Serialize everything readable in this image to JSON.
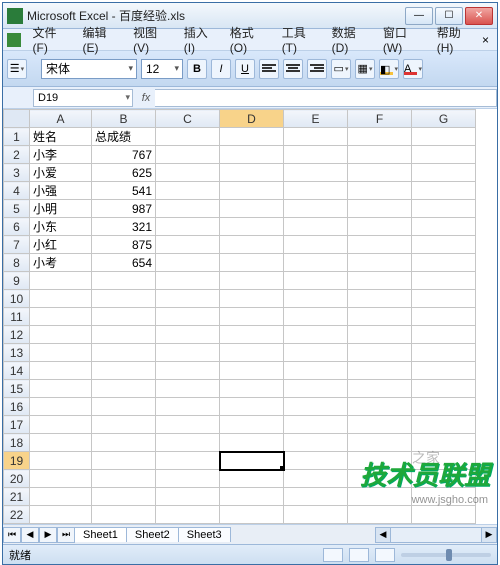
{
  "window": {
    "title": "Microsoft Excel - 百度经验.xls"
  },
  "menu": {
    "file": "文件(F)",
    "edit": "编辑(E)",
    "view": "视图(V)",
    "insert": "插入(I)",
    "format": "格式(O)",
    "tools": "工具(T)",
    "data": "数据(D)",
    "window": "窗口(W)",
    "help": "帮助(H)"
  },
  "toolbar": {
    "font_name": "宋体",
    "font_size": "12",
    "bold": "B",
    "italic": "I",
    "underline": "U"
  },
  "formula": {
    "name_box": "D19",
    "fx": "fx",
    "value": ""
  },
  "columns": [
    "A",
    "B",
    "C",
    "D",
    "E",
    "F",
    "G"
  ],
  "active_cell": "D19",
  "rows": [
    {
      "n": 1,
      "A": "姓名",
      "B": "总成绩"
    },
    {
      "n": 2,
      "A": "小李",
      "B": 767
    },
    {
      "n": 3,
      "A": "小爱",
      "B": 625
    },
    {
      "n": 4,
      "A": "小强",
      "B": 541
    },
    {
      "n": 5,
      "A": "小明",
      "B": 987
    },
    {
      "n": 6,
      "A": "小东",
      "B": 321
    },
    {
      "n": 7,
      "A": "小红",
      "B": 875
    },
    {
      "n": 8,
      "A": "小考",
      "B": 654
    },
    {
      "n": 9
    },
    {
      "n": 10
    },
    {
      "n": 11
    },
    {
      "n": 12
    },
    {
      "n": 13
    },
    {
      "n": 14
    },
    {
      "n": 15
    },
    {
      "n": 16
    },
    {
      "n": 17
    },
    {
      "n": 18
    },
    {
      "n": 19
    },
    {
      "n": 20
    },
    {
      "n": 21
    },
    {
      "n": 22
    }
  ],
  "sheets": {
    "s1": "Sheet1",
    "s2": "Sheet2",
    "s3": "Sheet3"
  },
  "status": {
    "ready": "就绪"
  },
  "watermark": {
    "main": "技术员联盟",
    "url": "www.jsgho.com",
    "side": "之家"
  }
}
